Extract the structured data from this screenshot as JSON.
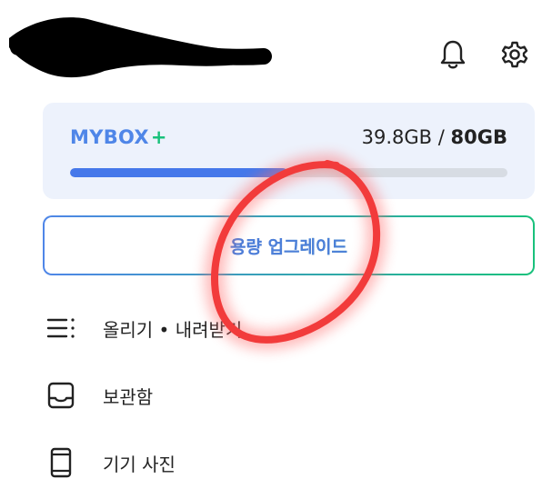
{
  "header": {
    "icons": [
      "bell-icon",
      "gear-icon"
    ]
  },
  "storage": {
    "plan_name": "MYBOX",
    "plan_suffix": "+",
    "used": "39.8GB",
    "separator": " / ",
    "total": "80GB",
    "usage_fraction": 0.4975,
    "colors": {
      "plan": "#4f86e8",
      "plus": "#19c17c",
      "bar_fill": "#4578ea",
      "bar_track": "#d7dce3",
      "card_bg": "#edf2fc"
    }
  },
  "upgrade_button": {
    "label": "용량 업그레이드"
  },
  "menu": [
    {
      "icon": "list-icon",
      "label": "올리기 • 내려받기"
    },
    {
      "icon": "inbox-icon",
      "label": "보관함"
    },
    {
      "icon": "phone-icon",
      "label": "기기 사진"
    }
  ]
}
